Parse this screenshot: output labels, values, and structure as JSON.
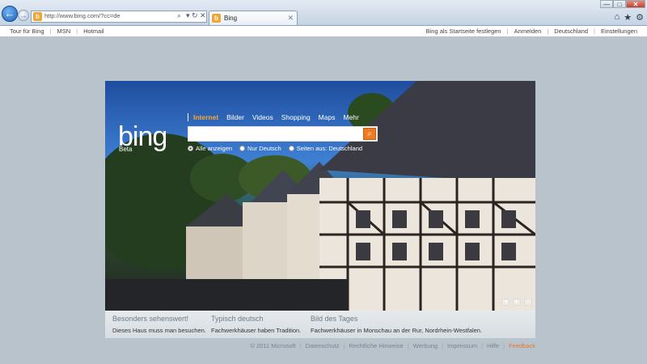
{
  "browser": {
    "url": "http://www.bing.com/?cc=de",
    "tab_title": "Bing",
    "favicon_letter": "b",
    "back_icon": "←",
    "forward_icon": "→",
    "search_icon": "⌕",
    "refresh_icon": "↻",
    "stop_icon": "✕",
    "tab_close": "✕",
    "dropdown_icon": "▾",
    "tools": [
      "⌂",
      "★",
      "⚙"
    ],
    "window": {
      "minimize": "—",
      "maximize": "□",
      "close": "✕"
    }
  },
  "topnav": {
    "left": [
      "Tour für Bing",
      "MSN",
      "Hotmail"
    ],
    "right": [
      "Bing als Startseite festlegen",
      "Anmelden",
      "Deutschland",
      "Einstellungen"
    ]
  },
  "bing": {
    "logo": "bing",
    "beta": "Beta",
    "scopes": [
      "Internet",
      "Bilder",
      "Videos",
      "Shopping",
      "Maps",
      "Mehr"
    ],
    "search_value": "",
    "search_button_icon": "⌕",
    "options": [
      {
        "label": "Alle anzeigen",
        "selected": true
      },
      {
        "label": "Nur Deutsch",
        "selected": false
      },
      {
        "label": "Seiten aus: Deutschland",
        "selected": false
      }
    ]
  },
  "info": [
    {
      "title": "Besonders sehenswert!",
      "text": "Dieses Haus muss man besuchen."
    },
    {
      "title": "Typisch deutsch",
      "text": "Fachwerkhäuser haben Tradition."
    },
    {
      "title": "Bild des Tages",
      "text": "Fachwerkhäuser in Monschau an der Rur, Nordrhein-Westfalen."
    }
  ],
  "footer": [
    "© 2011 Microsoft",
    "Datenschutz",
    "Rechtliche Hinweise",
    "Werbung",
    "Impressum",
    "Hilfe",
    "Feedback"
  ],
  "colors": {
    "accent": "#f07a1f",
    "active_scope": "#f7a536",
    "feedback": "#e07a2f"
  }
}
